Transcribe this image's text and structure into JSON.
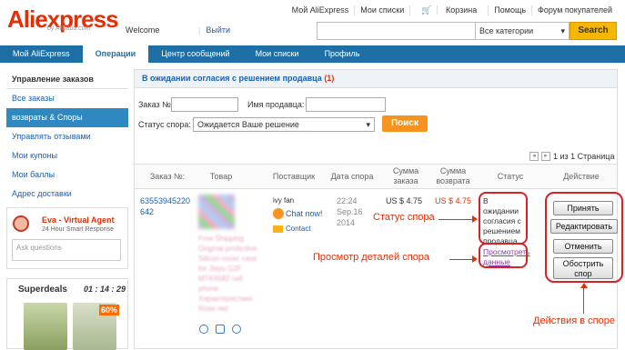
{
  "header": {
    "logo_text_ali": "Ali",
    "logo_text_express": "express",
    "logo_sub": "by Alibaba.com",
    "welcome": "Welcome",
    "signin": "Выйти",
    "top_links": [
      "Мой AliExpress",
      "Мои списки",
      "Корзина",
      "Помощь",
      "Форум покупателей"
    ],
    "search_category": "Все категории",
    "search_button": "Search"
  },
  "navbar": {
    "tabs": [
      "Мой AliExpress",
      "Операции",
      "Центр сообщений",
      "Мои списки",
      "Профиль"
    ],
    "active_index": 1
  },
  "sidebar": {
    "heading": "Управление заказов",
    "items": [
      "Все заказы",
      "возвраты & Споры",
      "Управлять отзывами",
      "Мои купоны",
      "Мои баллы",
      "Адрес доставки"
    ],
    "active_index": 1
  },
  "agent": {
    "name": "Eva - Virtual Agent",
    "sub": "24 Hour Smart Response",
    "input_placeholder": "Ask questions"
  },
  "superdeals": {
    "title": "Superdeals",
    "timer": "01 : 14 : 29",
    "badge": "60%"
  },
  "main": {
    "heading": "В ожидании согласия с решением продавца",
    "heading_count": "(1)",
    "order_label": "Заказ №:",
    "seller_label": "Имя продавца:",
    "status_label": "Статус спора:",
    "status_value": "Ожидается Ваше решение",
    "search_button": "Поиск",
    "pager_text": "1 из 1 Страница",
    "columns": [
      "Заказ №:",
      "Товар",
      "Поставщик",
      "Дата спора",
      "Сумма заказа",
      "Сумма возврата",
      "Статус",
      "Действие"
    ]
  },
  "row": {
    "order_no": "63553945220642",
    "product_text": "Free Shipping Original protective Silicon cover case for Jiayu G2F MTK6582 cell phone Характеристики Rose red",
    "seller_name": "ivy fan",
    "chat_label": "Chat now!",
    "contact_label": "Contact",
    "date": "22:24 Sep.16 2014",
    "order_sum": "US $ 4.75",
    "refund_sum": "US $ 4.75",
    "status": "В ожидании согласия с решением продавца",
    "view_link": "Просмотреть данные",
    "actions": [
      "Принять",
      "Редактировать",
      "Отменить",
      "Обострить спор"
    ]
  },
  "annotations": {
    "status": "Статус спора",
    "details": "Просмотр деталей спора",
    "actions": "Действия в споре"
  }
}
